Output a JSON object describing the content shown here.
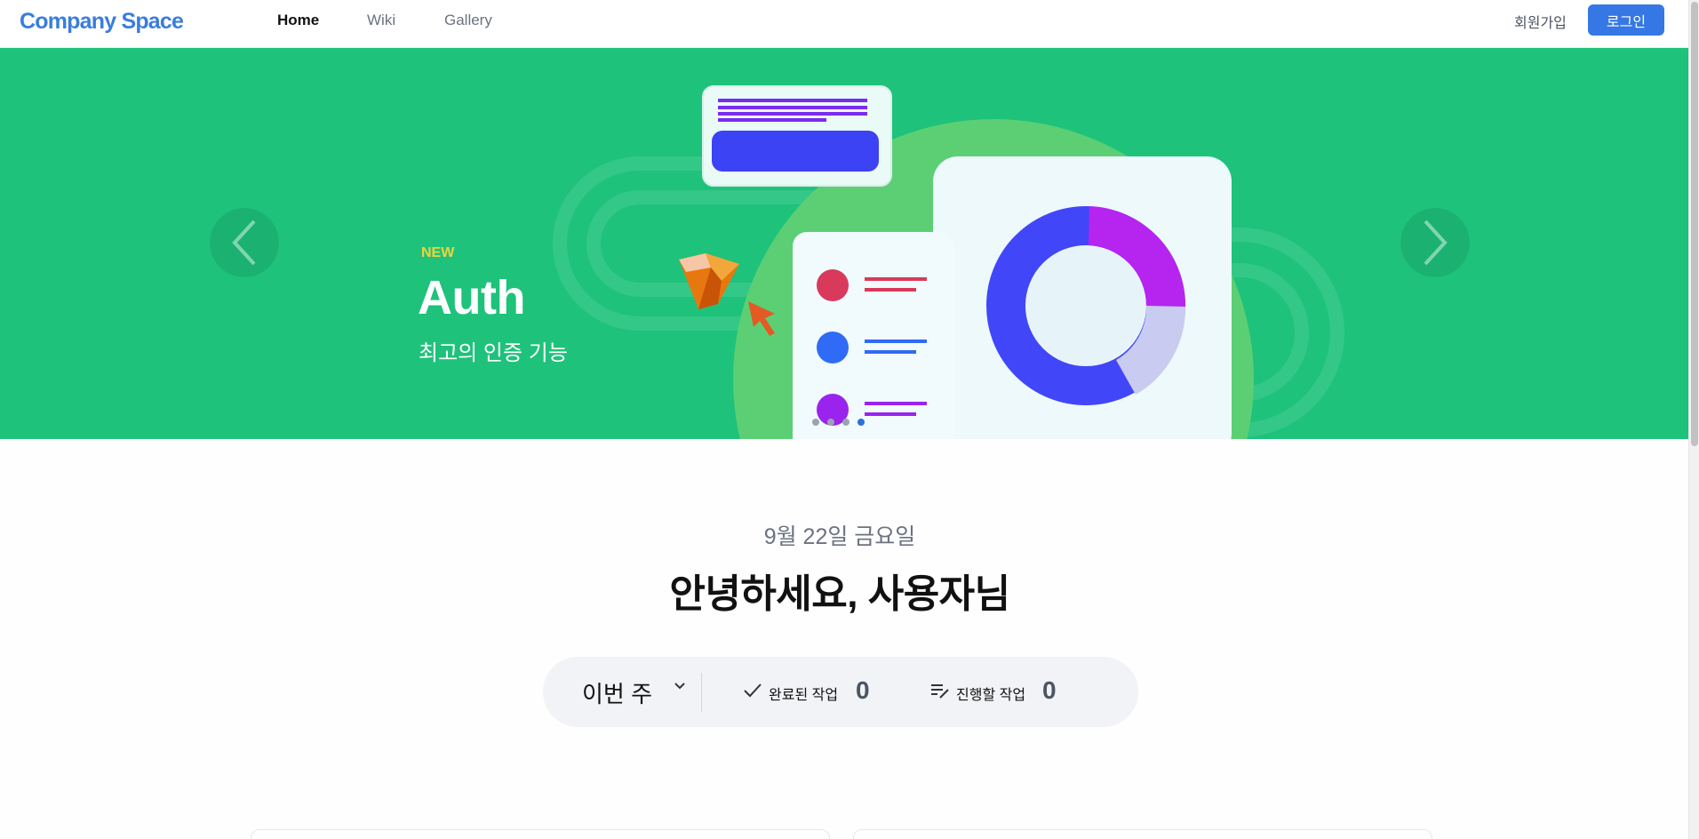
{
  "nav": {
    "logo": "Company Space",
    "links": [
      {
        "label": "Home",
        "active": true
      },
      {
        "label": "Wiki",
        "active": false
      },
      {
        "label": "Gallery",
        "active": false
      }
    ],
    "signup_label": "회원가입",
    "login_label": "로그인"
  },
  "hero": {
    "badge": "NEW",
    "title": "Auth",
    "subtitle": "최고의 인증 기능",
    "slide_count": 4,
    "active_slide": 4,
    "colors": {
      "background": "#1ec27b",
      "badge": "#f3d23a"
    }
  },
  "greeting": {
    "date": "9월 22일 금요일",
    "message": "안녕하세요, 사용자님"
  },
  "stats": {
    "period": "이번 주",
    "completed_label": "완료된 작업",
    "completed_value": "0",
    "todo_label": "진행할 작업",
    "todo_value": "0"
  },
  "icons": [
    "chevron-left-icon",
    "chevron-right-icon",
    "chevron-down-icon",
    "check-icon",
    "edit-list-icon"
  ]
}
